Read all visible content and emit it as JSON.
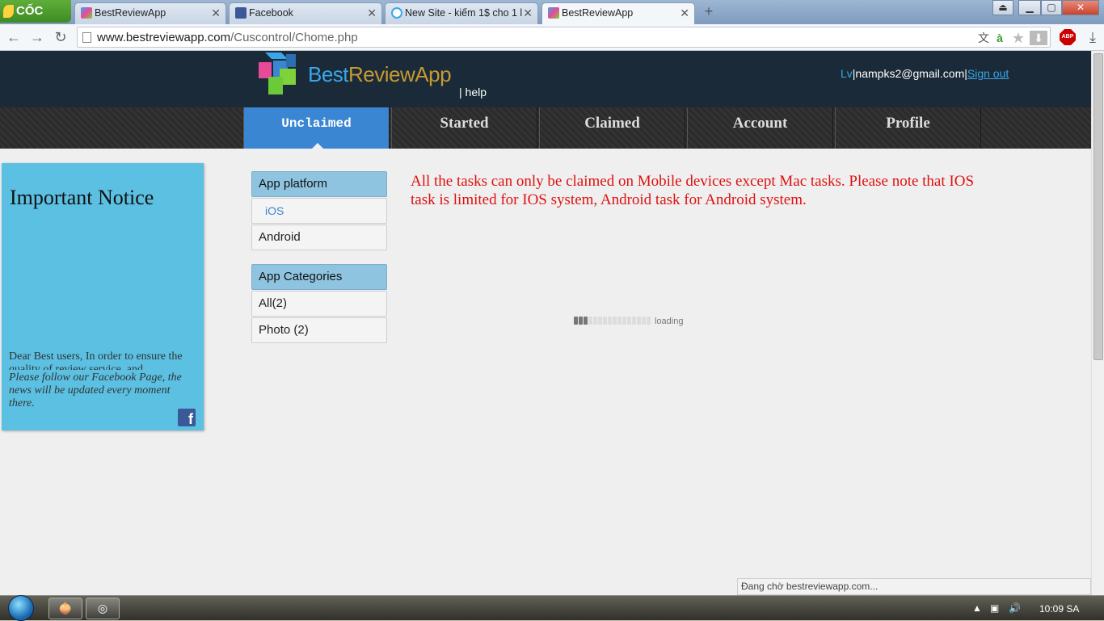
{
  "browser": {
    "brand": "CỐC CỐC",
    "tabs": [
      {
        "title": "BestReviewApp",
        "active": false
      },
      {
        "title": "Facebook",
        "active": false
      },
      {
        "title": "New Site - kiếm 1$ cho 1 l",
        "active": false
      },
      {
        "title": "BestReviewApp",
        "active": true
      }
    ],
    "new_tab_symbol": "+",
    "close_symbol": "✕",
    "url_domain": "www.bestreviewapp.com",
    "url_path": "/Cuscontrol/Chome.php",
    "abp_label": "ABP",
    "status_text": "Đang chờ bestreviewapp.com..."
  },
  "site": {
    "logo_part1": "Best",
    "logo_part2": "ReviewApp",
    "help": "| help",
    "user": {
      "level": "Lv",
      "email": "|nampks2@gmail.com|",
      "sign_out": "Sign out"
    },
    "nav": [
      {
        "label": "Unclaimed",
        "active": true
      },
      {
        "label": "Started",
        "active": false
      },
      {
        "label": "Claimed",
        "active": false
      },
      {
        "label": "Account",
        "active": false
      },
      {
        "label": "Profile",
        "active": false
      }
    ],
    "notice": {
      "title": "Important Notice",
      "body": "Dear Best users, In order to ensure the quality of review service, and",
      "follow": "Please follow our Facebook Page, the news will be updated every moment there.",
      "fb_letter": "f"
    },
    "filters": {
      "platform_title": "App platform",
      "platform_items": [
        "iOS",
        "Android"
      ],
      "categories_title": "App Categories",
      "category_items": [
        "All(2)",
        "Photo (2)"
      ]
    },
    "warning": "All the tasks can only be claimed on Mobile devices except Mac tasks. Please note that IOS task is limited for IOS system, Android task for Android system.",
    "loading_label": "loading",
    "loading_progress_segments_on": 3,
    "loading_progress_segments_total": 16
  },
  "taskbar": {
    "clock": "10:09 SA"
  },
  "colors": {
    "accent_blue": "#3a86d2",
    "header_bg": "#1a2a38",
    "warning_red": "#e01010",
    "notice_bg": "#5bc0e2"
  }
}
